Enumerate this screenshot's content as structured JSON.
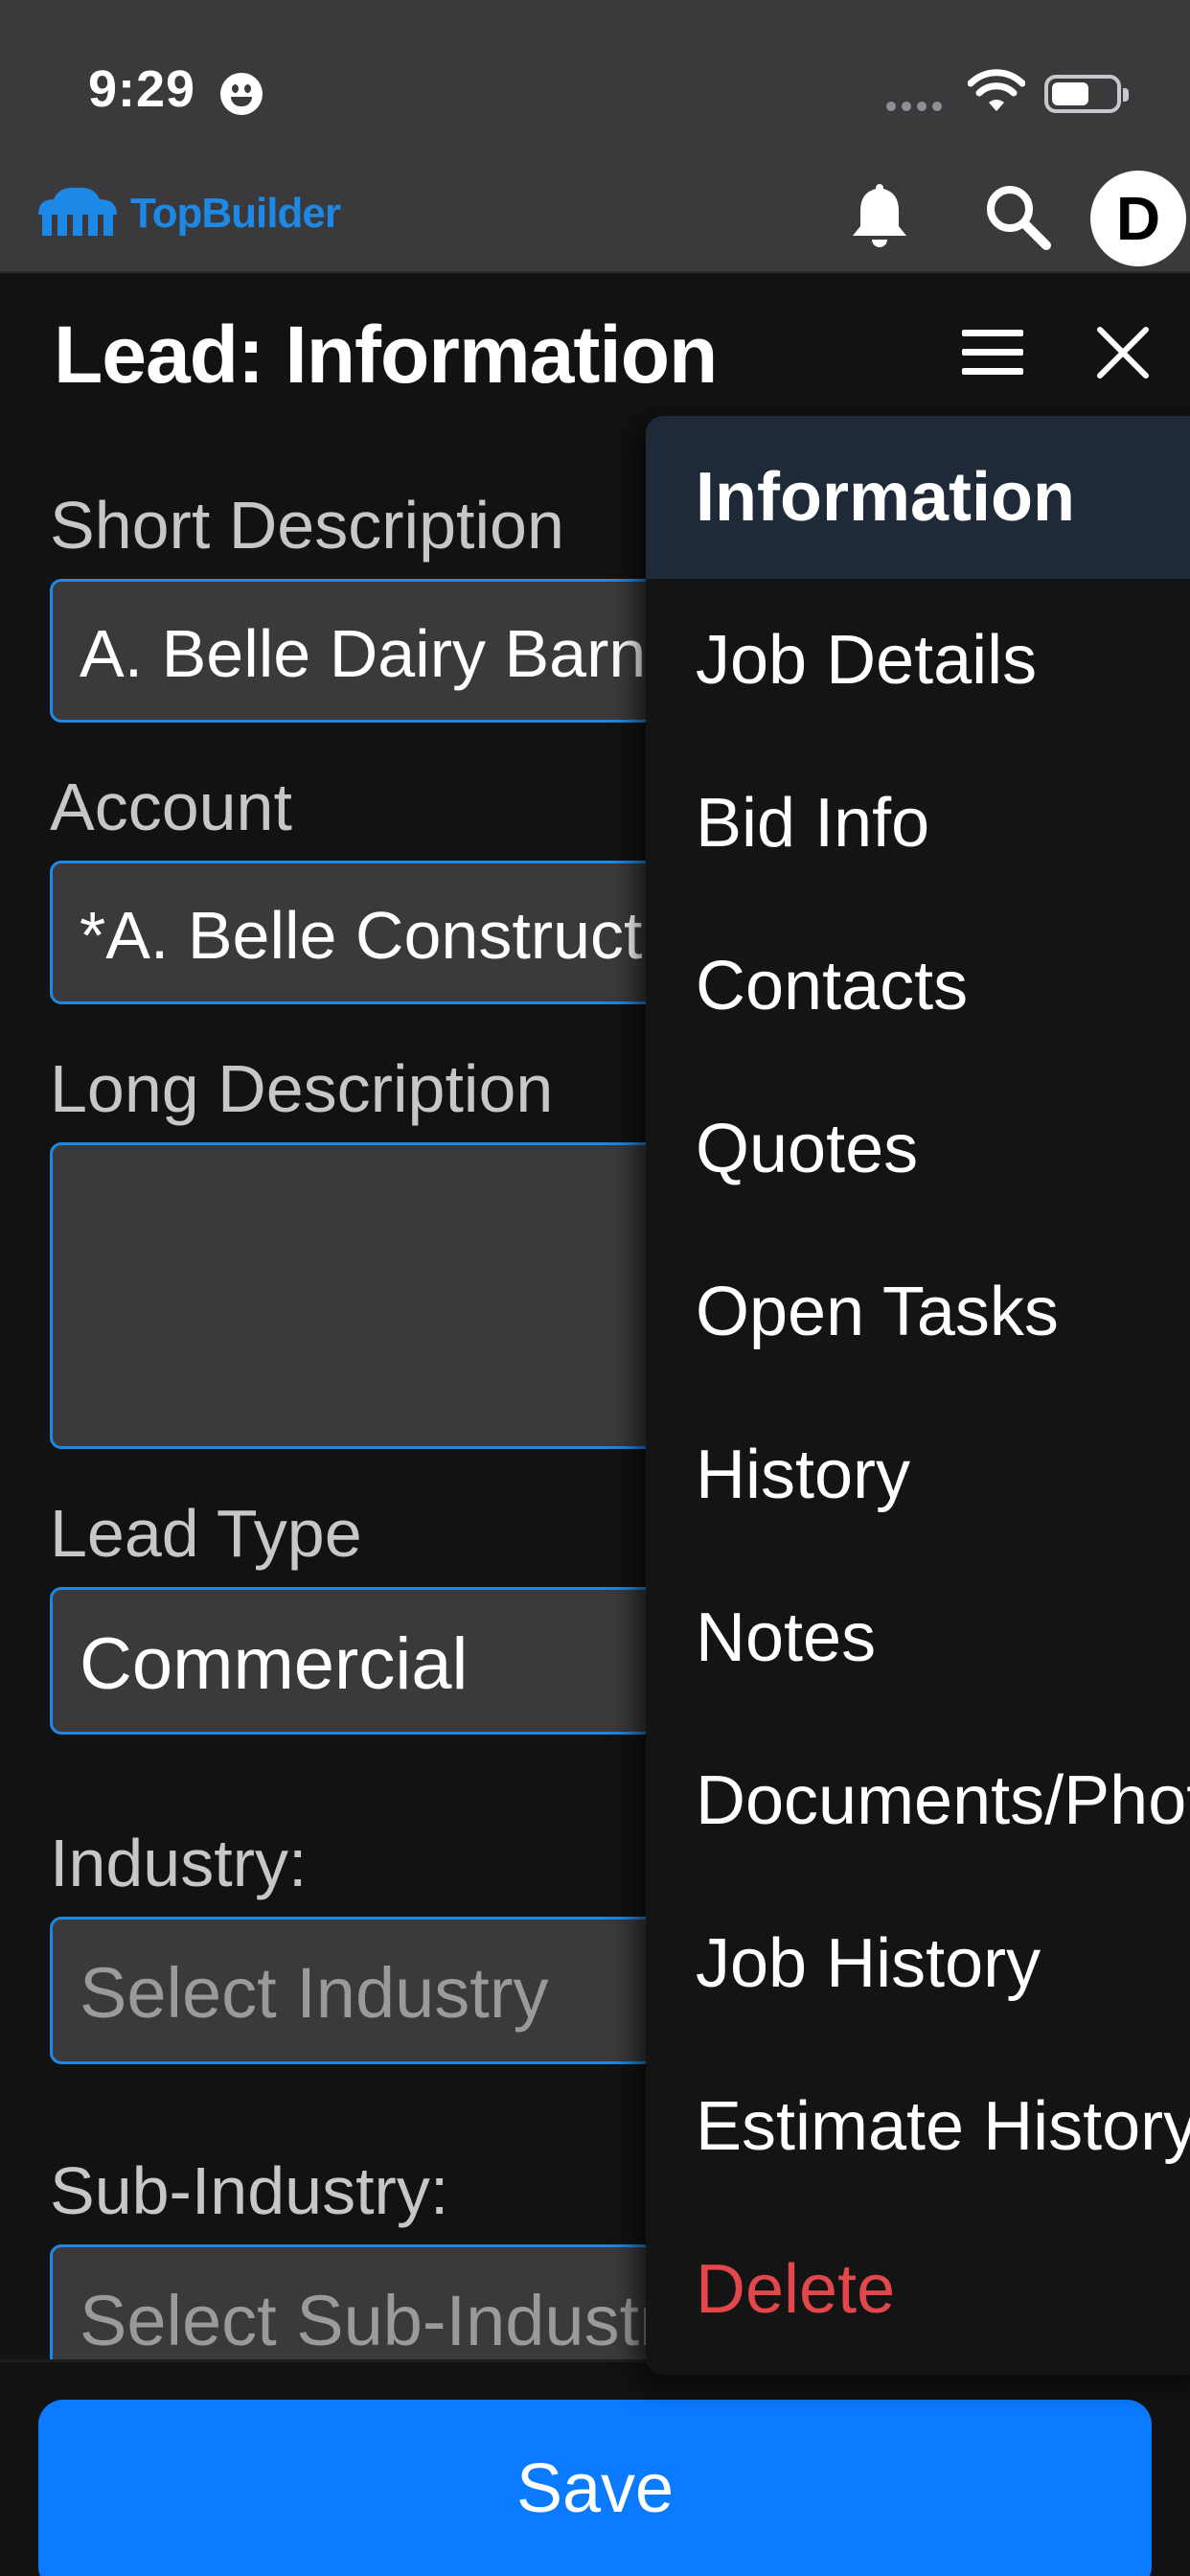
{
  "status_bar": {
    "time": "9:29"
  },
  "header": {
    "logo_text": "TopBuilder",
    "avatar_initial": "D"
  },
  "page": {
    "title": "Lead: Information"
  },
  "form": {
    "short_description": {
      "label": "Short Description",
      "value": "A. Belle Dairy Barn"
    },
    "account": {
      "label": "Account",
      "value": "*A. Belle Construction"
    },
    "long_description": {
      "label": "Long Description",
      "value": ""
    },
    "lead_type": {
      "label": "Lead Type",
      "value": "Commercial"
    },
    "industry": {
      "label": "Industry:",
      "placeholder": "Select Industry"
    },
    "sub_industry": {
      "label": "Sub-Industry:",
      "placeholder": "Select Sub-Industry"
    }
  },
  "menu": {
    "items": [
      {
        "label": "Information",
        "active": true
      },
      {
        "label": "Job Details"
      },
      {
        "label": "Bid Info"
      },
      {
        "label": "Contacts"
      },
      {
        "label": "Quotes"
      },
      {
        "label": "Open Tasks"
      },
      {
        "label": "History"
      },
      {
        "label": "Notes"
      },
      {
        "label": "Documents/Photos"
      },
      {
        "label": "Job History"
      },
      {
        "label": "Estimate History"
      },
      {
        "label": "Delete",
        "danger": true
      }
    ]
  },
  "actions": {
    "save_label": "Save"
  },
  "colors": {
    "accent": "#0a7aff",
    "brand": "#1e88e5",
    "danger": "#e2474b",
    "active_menu_bg": "#1f2a38"
  }
}
